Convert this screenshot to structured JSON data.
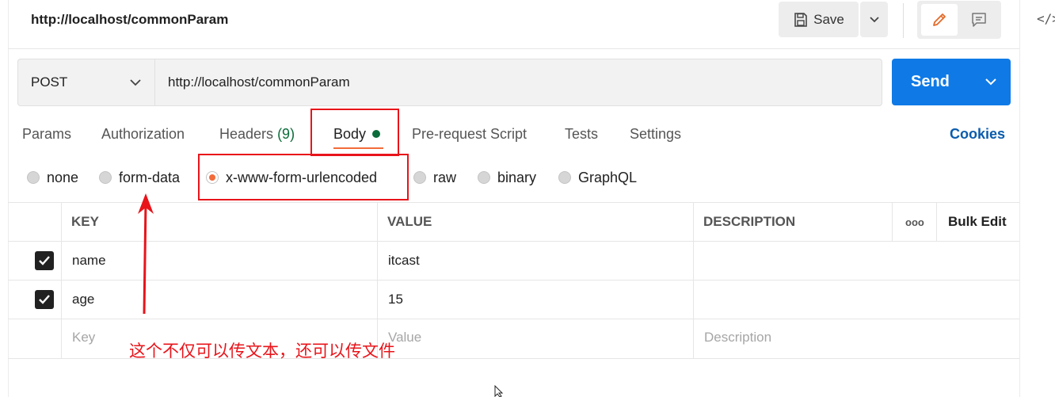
{
  "header": {
    "request_name": "http://localhost/commonParam",
    "save_label": "Save",
    "save_icon": "floppy-disk-icon",
    "edit_icon": "pencil-icon",
    "comment_icon": "comment-icon",
    "code_icon": "</>"
  },
  "request": {
    "method": "POST",
    "url": "http://localhost/commonParam",
    "send_label": "Send"
  },
  "tabs": {
    "params": "Params",
    "authorization": "Authorization",
    "headers": "Headers",
    "headers_count": "(9)",
    "body": "Body",
    "prerequest": "Pre-request Script",
    "tests": "Tests",
    "settings": "Settings",
    "cookies": "Cookies"
  },
  "body_types": {
    "none": "none",
    "form_data": "form-data",
    "urlencoded": "x-www-form-urlencoded",
    "raw": "raw",
    "binary": "binary",
    "graphql": "GraphQL",
    "selected": "x-www-form-urlencoded"
  },
  "table": {
    "headers": {
      "key": "KEY",
      "value": "VALUE",
      "description": "DESCRIPTION",
      "more": "ooo",
      "bulk_edit": "Bulk Edit"
    },
    "rows": [
      {
        "key": "name",
        "value": "itcast",
        "description": "",
        "checked": true
      },
      {
        "key": "age",
        "value": "15",
        "description": "",
        "checked": true
      }
    ],
    "placeholders": {
      "key": "Key",
      "value": "Value",
      "description": "Description"
    }
  },
  "annotation": {
    "text": "这个不仅可以传文本，还可以传文件",
    "color": "#e8141a"
  },
  "colors": {
    "send_button": "#0f7ae6",
    "active_tab": "#f26b3a",
    "body_dot": "#0b6b3a",
    "cookies_link": "#0b5cad"
  }
}
